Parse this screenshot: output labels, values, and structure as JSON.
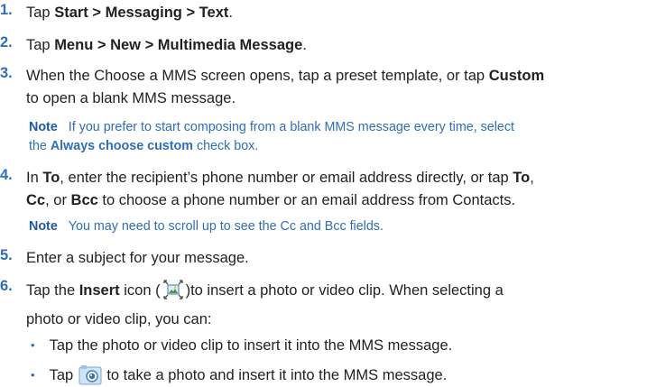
{
  "steps": [
    {
      "num": "1.",
      "parts": [
        [
          "Tap ",
          false
        ],
        [
          "Start > Messaging > Text",
          true
        ],
        [
          ".",
          false
        ]
      ]
    },
    {
      "num": "2.",
      "parts": [
        [
          "Tap ",
          false
        ],
        [
          "Menu > New > Multimedia Message",
          true
        ],
        [
          ".",
          false
        ]
      ]
    },
    {
      "num": "3.",
      "line1": [
        [
          "When the Choose a MMS screen opens, tap a preset template, or tap ",
          false
        ],
        [
          "Custom",
          true
        ]
      ],
      "line2": [
        [
          "to open a blank MMS message.",
          false
        ]
      ]
    },
    {
      "num": "4.",
      "line1": [
        [
          "In ",
          false
        ],
        [
          "To",
          true
        ],
        [
          ", enter the recipient’s phone number or email address directly, or tap ",
          false
        ],
        [
          "To",
          true
        ],
        [
          ",",
          false
        ]
      ],
      "line2": [
        [
          "Cc",
          true
        ],
        [
          ", or ",
          false
        ],
        [
          "Bcc",
          true
        ],
        [
          " to choose a phone number or an email address from Contacts.",
          false
        ]
      ]
    },
    {
      "num": "5.",
      "parts": [
        [
          "Enter a subject for your message.",
          false
        ]
      ]
    },
    {
      "num": "6.",
      "line1a": [
        [
          "Tap the ",
          false
        ],
        [
          "Insert",
          true
        ],
        [
          " icon (",
          false
        ]
      ],
      "line1b": ")to insert a photo or video clip. When selecting a",
      "line2": "photo or video clip, you can:"
    }
  ],
  "notes": [
    {
      "label": "Note",
      "line1": "If you prefer to start composing from a blank MMS message every time, select",
      "line2_pre": "the ",
      "line2_bold": "Always choose custom",
      "line2_post": " check box."
    },
    {
      "label": "Note",
      "line1": "You may need to scroll up to see the Cc and Bcc fields."
    }
  ],
  "bullets": [
    {
      "text": "Tap the photo or video clip to insert it into the MMS message."
    },
    {
      "pre": "Tap ",
      "post": " to take a photo and insert it into the MMS message."
    }
  ],
  "colors": {
    "step_number": "#2e6fb7",
    "note": "#2e6fb7",
    "body_text": "#231f20"
  },
  "icons": {
    "insert": "insert-picture-icon",
    "camera": "camera-icon"
  }
}
